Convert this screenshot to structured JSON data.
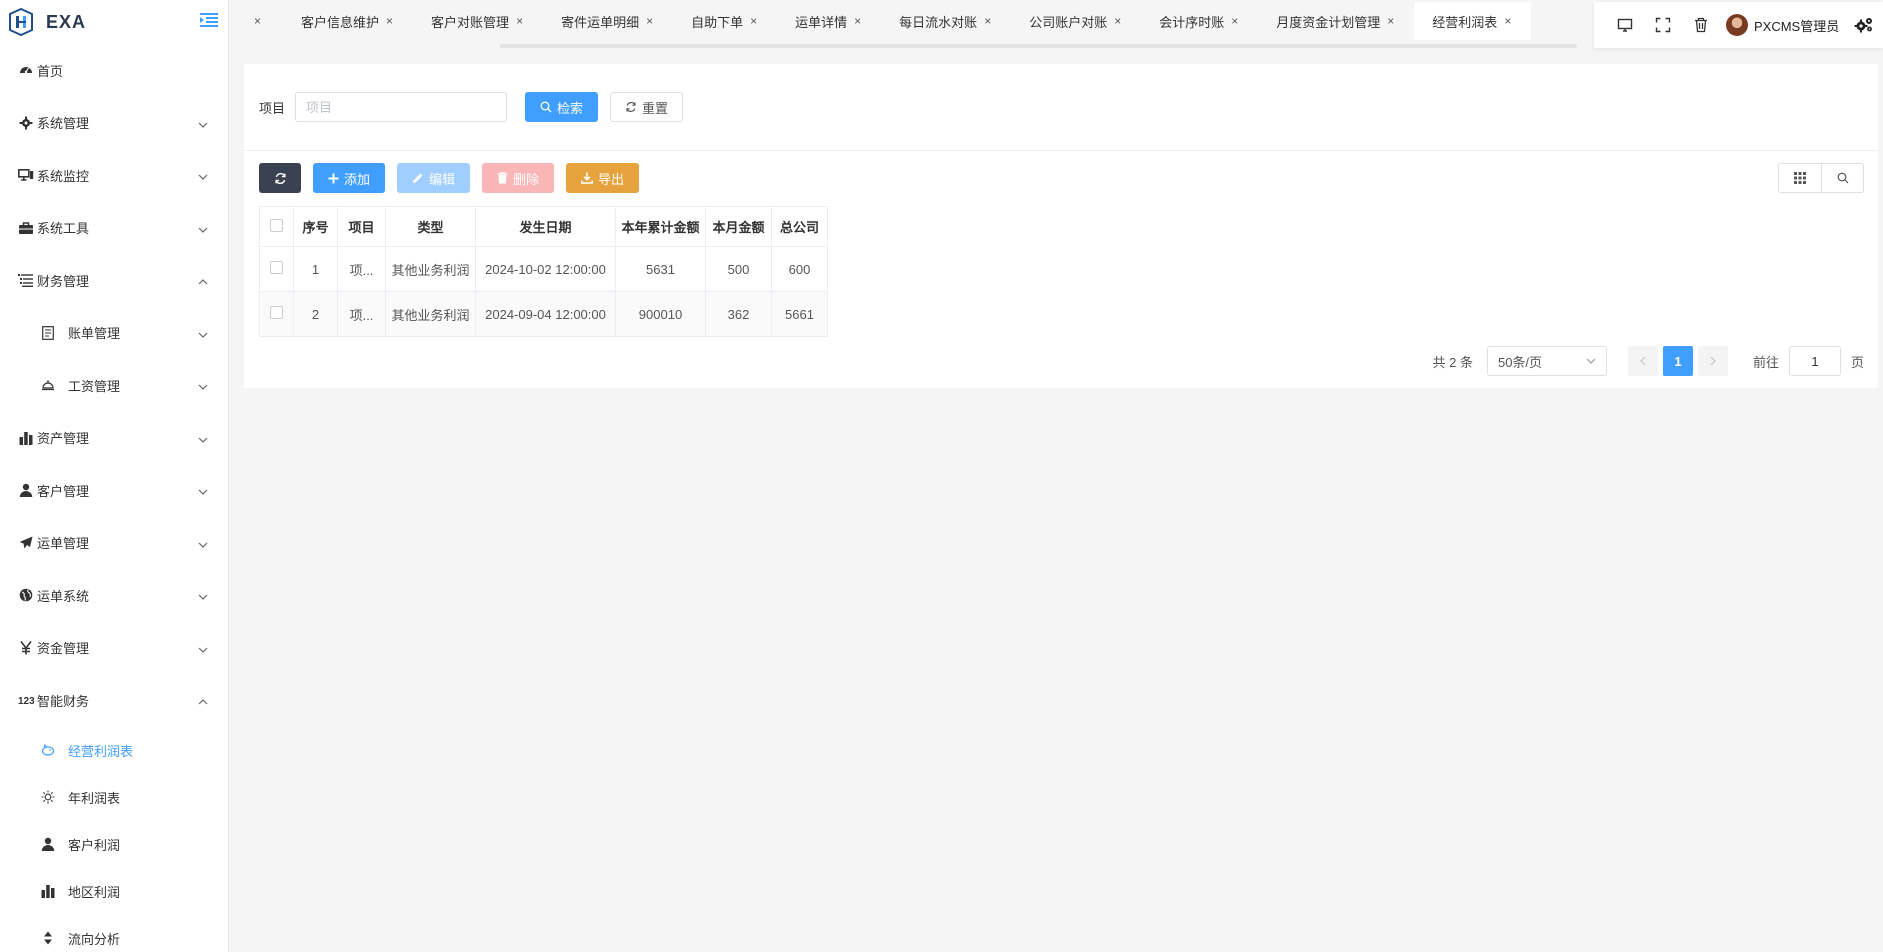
{
  "brand": {
    "name": "EXA",
    "accent": "#409eff"
  },
  "sidebar": {
    "items": [
      {
        "label": "首页",
        "icon": "dashboard-icon",
        "type": "top",
        "chevron": ""
      },
      {
        "label": "系统管理",
        "icon": "gear-icon",
        "type": "top",
        "chevron": "down"
      },
      {
        "label": "系统监控",
        "icon": "monitor-icon",
        "type": "top",
        "chevron": "down"
      },
      {
        "label": "系统工具",
        "icon": "toolbox-icon",
        "type": "top",
        "chevron": "down"
      },
      {
        "label": "财务管理",
        "icon": "list-tree-icon",
        "type": "top",
        "chevron": "up"
      },
      {
        "label": "账单管理",
        "icon": "document-icon",
        "type": "sub",
        "chevron": "down"
      },
      {
        "label": "工资管理",
        "icon": "bell-icon",
        "type": "sub",
        "chevron": "down"
      },
      {
        "label": "资产管理",
        "icon": "bar-chart-icon",
        "type": "top",
        "chevron": "down"
      },
      {
        "label": "客户管理",
        "icon": "user-icon",
        "type": "top",
        "chevron": "down"
      },
      {
        "label": "运单管理",
        "icon": "paper-plane-icon",
        "type": "top",
        "chevron": "down"
      },
      {
        "label": "运单系统",
        "icon": "globe-icon",
        "type": "top",
        "chevron": "down"
      },
      {
        "label": "资金管理",
        "icon": "yen-icon",
        "type": "top",
        "chevron": "down"
      },
      {
        "label": "智能财务",
        "icon": "number-123-icon",
        "type": "top",
        "chevron": "up"
      },
      {
        "label": "经营利润表",
        "icon": "pig-icon",
        "type": "leaf",
        "chevron": "",
        "active": true
      },
      {
        "label": "年利润表",
        "icon": "sun-icon",
        "type": "leaf",
        "chevron": ""
      },
      {
        "label": "客户利润",
        "icon": "user-icon",
        "type": "leaf",
        "chevron": ""
      },
      {
        "label": "地区利润",
        "icon": "bar-chart-icon",
        "type": "leaf",
        "chevron": ""
      },
      {
        "label": "流向分析",
        "icon": "sort-icon",
        "type": "leaf",
        "chevron": ""
      }
    ]
  },
  "tabs": [
    {
      "label": "",
      "active": false
    },
    {
      "label": "客户信息维护",
      "active": false
    },
    {
      "label": "客户对账管理",
      "active": false
    },
    {
      "label": "寄件运单明细",
      "active": false
    },
    {
      "label": "自助下单",
      "active": false
    },
    {
      "label": "运单详情",
      "active": false
    },
    {
      "label": "每日流水对账",
      "active": false
    },
    {
      "label": "公司账户对账",
      "active": false
    },
    {
      "label": "会计序时账",
      "active": false
    },
    {
      "label": "月度资金计划管理",
      "active": false
    },
    {
      "label": "经营利润表",
      "active": true
    }
  ],
  "header": {
    "user_name": "PXCMS管理员"
  },
  "search": {
    "label": "项目",
    "placeholder": "项目",
    "value": "",
    "search_label": "检索",
    "reset_label": "重置"
  },
  "toolbar": {
    "add_label": "添加",
    "edit_label": "编辑",
    "delete_label": "删除",
    "export_label": "导出"
  },
  "table": {
    "columns": [
      "序号",
      "项目",
      "类型",
      "发生日期",
      "本年累计金额",
      "本月金额",
      "总公司"
    ],
    "rows": [
      [
        "1",
        "项...",
        "其他业务利润",
        "2024-10-02 12:00:00",
        "5631",
        "500",
        "600"
      ],
      [
        "2",
        "项...",
        "其他业务利润",
        "2024-09-04 12:00:00",
        "900010",
        "362",
        "5661"
      ]
    ]
  },
  "pagination": {
    "total_text": "共 2 条",
    "page_size": "50条/页",
    "current_page": "1",
    "goto_label": "前往",
    "goto_value": "1",
    "goto_suffix": "页"
  }
}
